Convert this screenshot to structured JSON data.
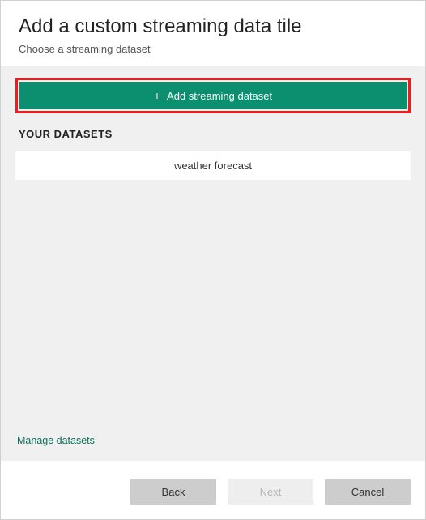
{
  "header": {
    "title": "Add a custom streaming data tile",
    "subtitle": "Choose a streaming dataset"
  },
  "content": {
    "add_button_label": "Add streaming dataset",
    "section_header": "YOUR DATASETS",
    "datasets": [
      {
        "name": "weather forecast"
      }
    ],
    "manage_link": "Manage datasets"
  },
  "footer": {
    "back_label": "Back",
    "next_label": "Next",
    "cancel_label": "Cancel"
  },
  "colors": {
    "accent": "#0b8f6f",
    "highlight_border": "#ee1c1c"
  }
}
